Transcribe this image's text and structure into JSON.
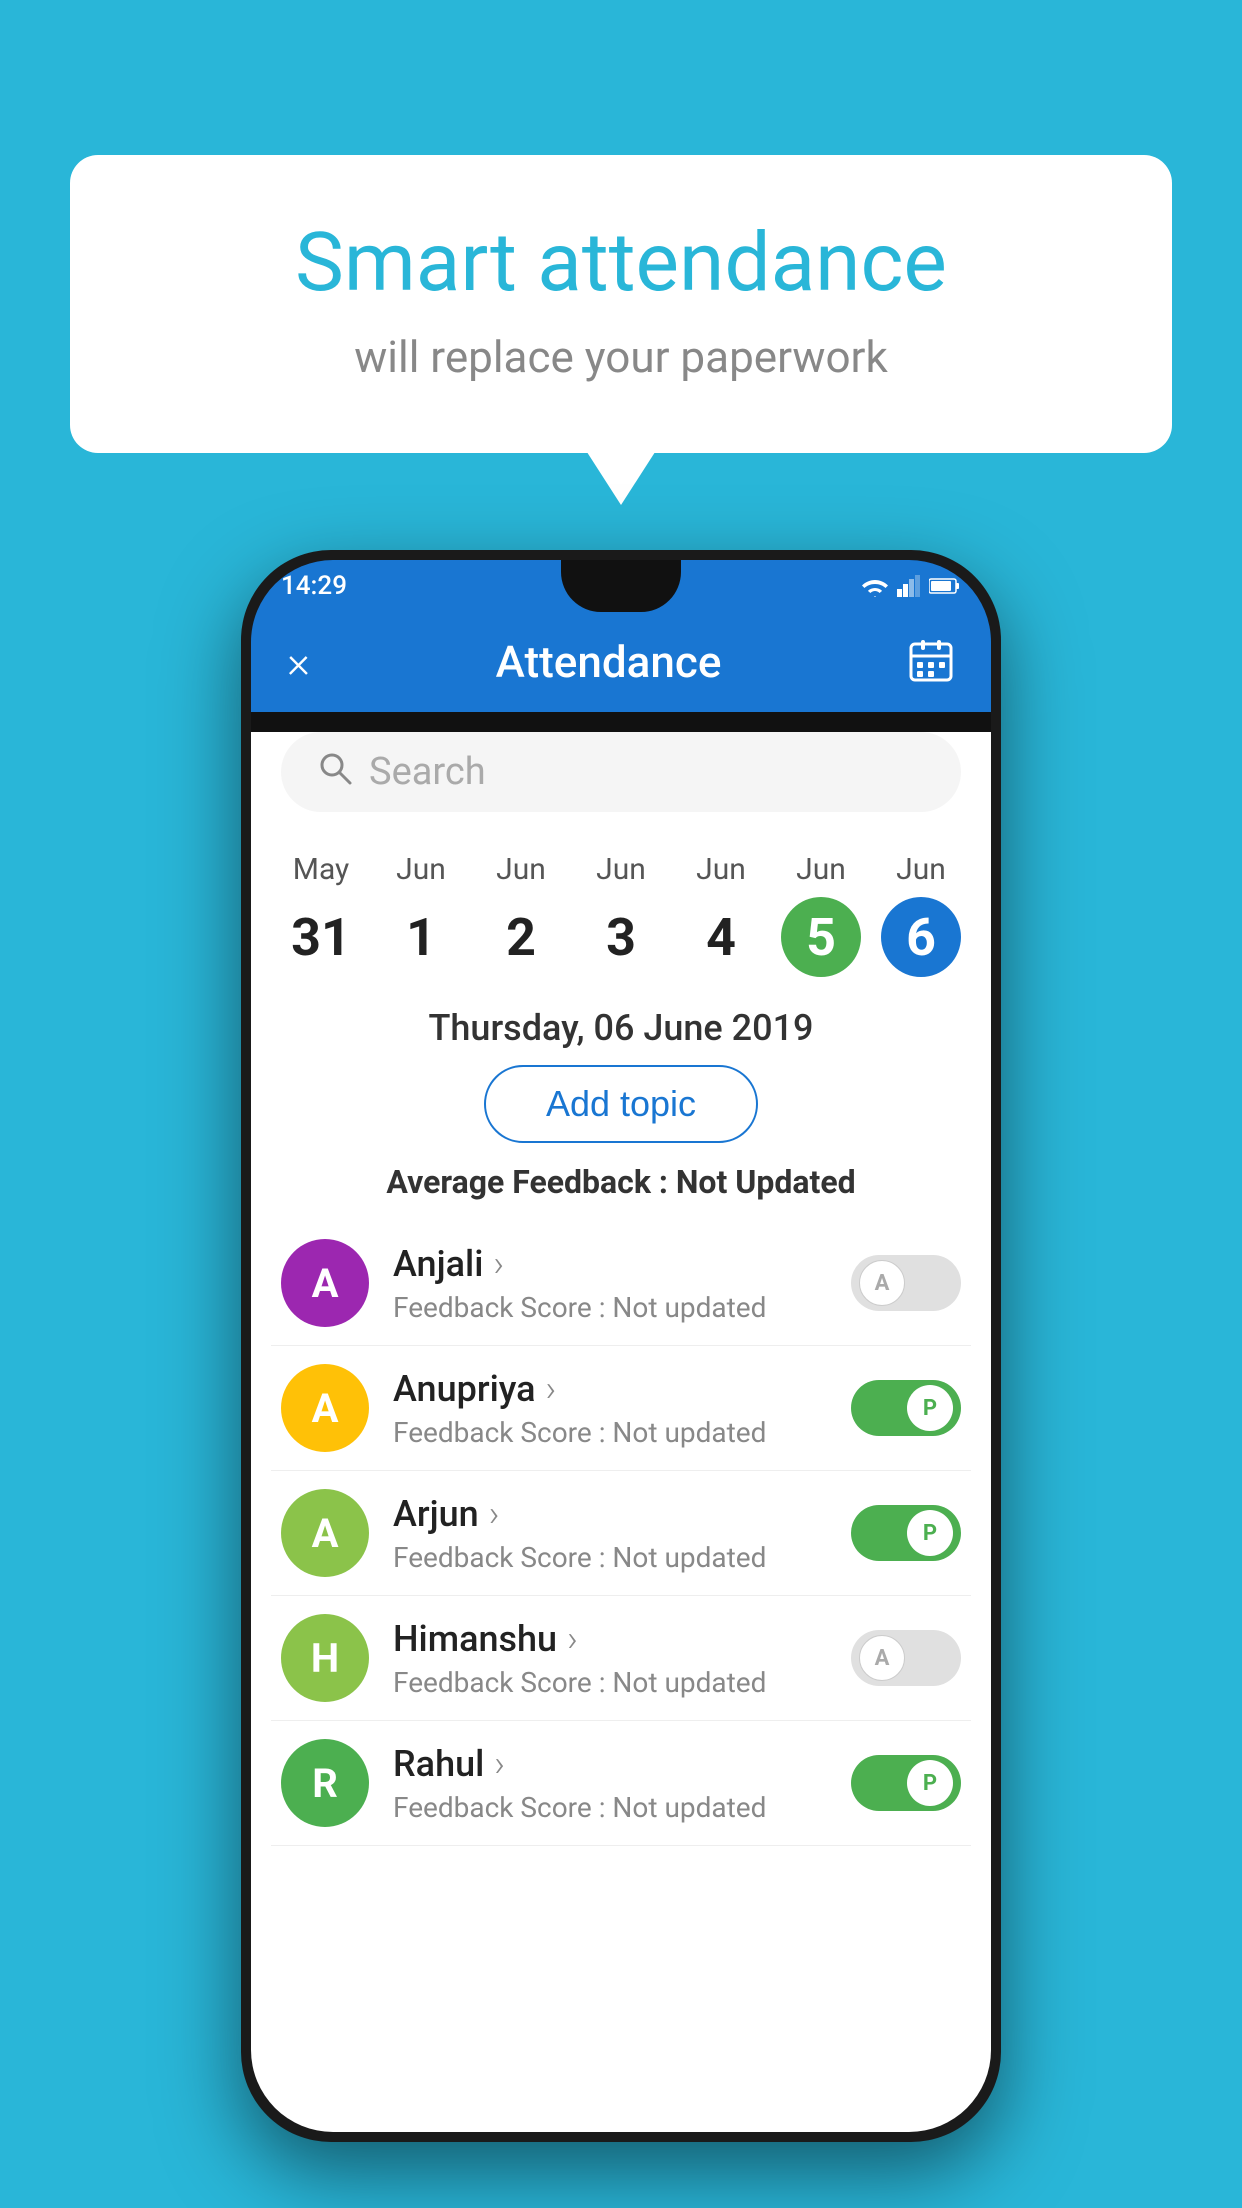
{
  "background_color": "#29b6d8",
  "bubble": {
    "title": "Smart attendance",
    "subtitle": "will replace your paperwork"
  },
  "status_bar": {
    "time": "14:29"
  },
  "app_bar": {
    "title": "Attendance",
    "close_label": "×"
  },
  "search": {
    "placeholder": "Search"
  },
  "calendar": {
    "days": [
      {
        "month": "May",
        "num": "31",
        "state": "normal"
      },
      {
        "month": "Jun",
        "num": "1",
        "state": "normal"
      },
      {
        "month": "Jun",
        "num": "2",
        "state": "normal"
      },
      {
        "month": "Jun",
        "num": "3",
        "state": "normal"
      },
      {
        "month": "Jun",
        "num": "4",
        "state": "normal"
      },
      {
        "month": "Jun",
        "num": "5",
        "state": "today"
      },
      {
        "month": "Jun",
        "num": "6",
        "state": "selected"
      }
    ]
  },
  "selected_date": "Thursday, 06 June 2019",
  "add_topic_label": "Add topic",
  "avg_feedback_label": "Average Feedback :",
  "avg_feedback_value": "Not Updated",
  "students": [
    {
      "name": "Anjali",
      "avatar_letter": "A",
      "avatar_color": "#9c27b0",
      "feedback_label": "Feedback Score : Not updated",
      "attendance": "absent"
    },
    {
      "name": "Anupriya",
      "avatar_letter": "A",
      "avatar_color": "#ffc107",
      "feedback_label": "Feedback Score : Not updated",
      "attendance": "present"
    },
    {
      "name": "Arjun",
      "avatar_letter": "A",
      "avatar_color": "#8bc34a",
      "feedback_label": "Feedback Score : Not updated",
      "attendance": "present"
    },
    {
      "name": "Himanshu",
      "avatar_letter": "H",
      "avatar_color": "#8bc34a",
      "feedback_label": "Feedback Score : Not updated",
      "attendance": "absent"
    },
    {
      "name": "Rahul",
      "avatar_letter": "R",
      "avatar_color": "#4caf50",
      "feedback_label": "Feedback Score : Not updated",
      "attendance": "present"
    }
  ]
}
